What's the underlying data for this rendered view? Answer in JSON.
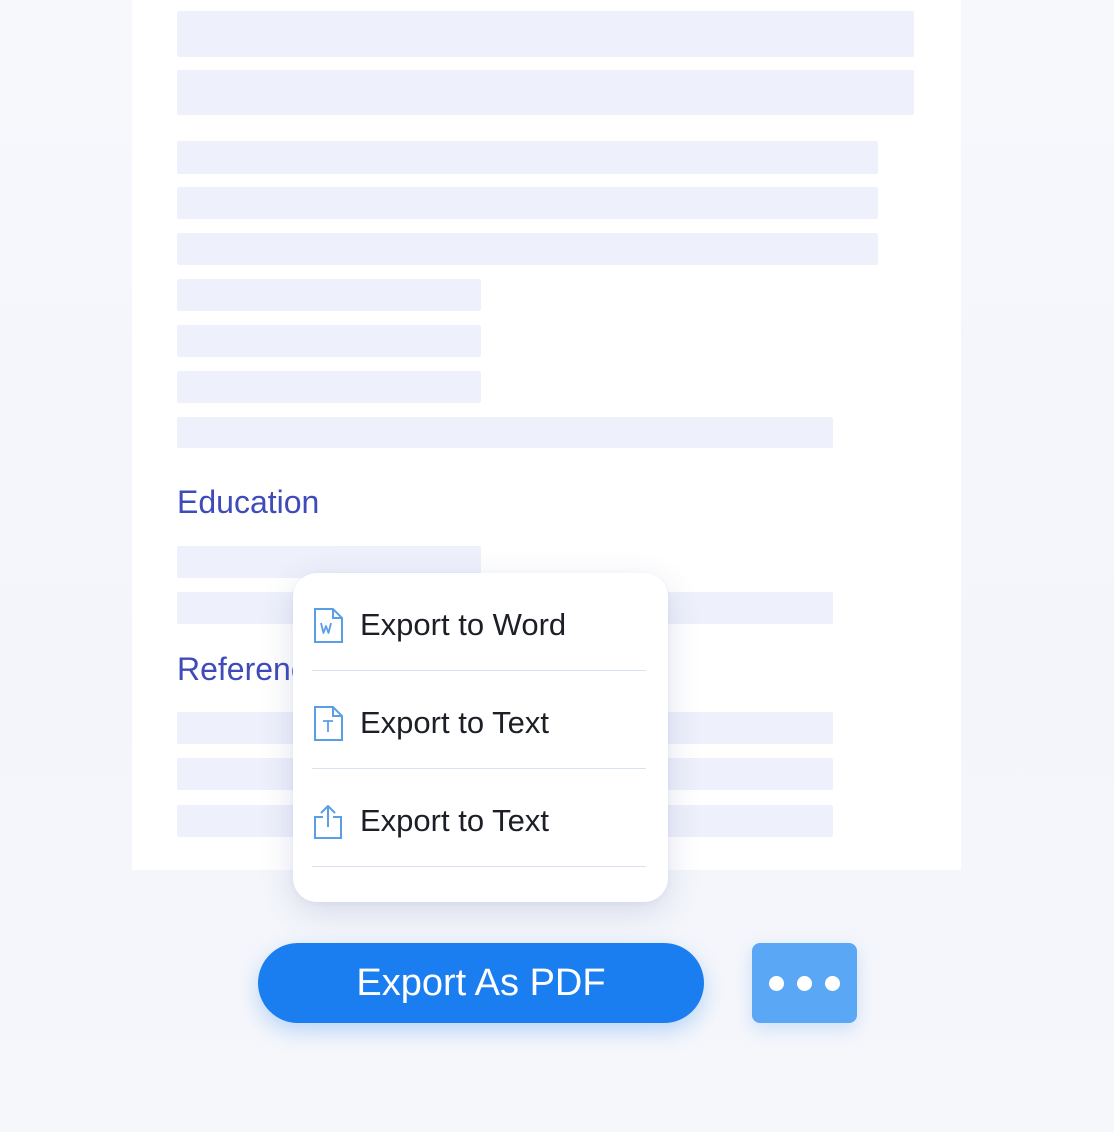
{
  "document": {
    "sections": [
      {
        "heading": "Education"
      },
      {
        "heading": "References"
      }
    ]
  },
  "export_menu": {
    "items": [
      {
        "label": "Export to Word",
        "icon": "word-document-icon"
      },
      {
        "label": "Export to Text",
        "icon": "text-document-icon"
      },
      {
        "label": "Export to Text",
        "icon": "share-upload-icon"
      }
    ]
  },
  "actions": {
    "export_pdf_label": "Export As PDF",
    "more_icon": "more-horizontal-icon"
  },
  "colors": {
    "accent": "#1a7ef0",
    "more_button": "#5aa8f5",
    "heading": "#3f4bb8",
    "placeholder": "#eef0fb",
    "icon_blue": "#5b9ee8"
  }
}
